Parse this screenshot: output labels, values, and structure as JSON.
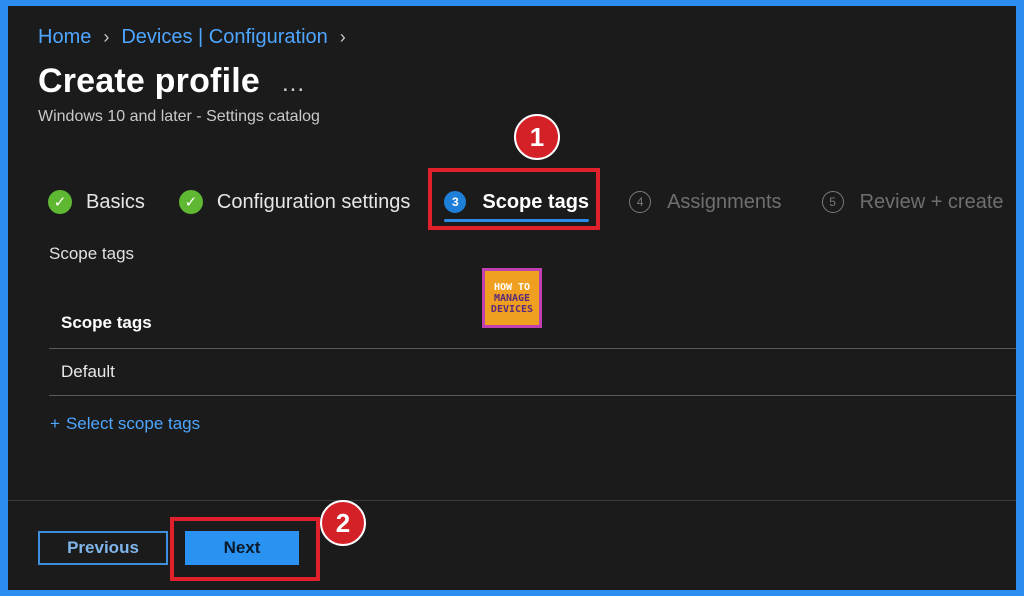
{
  "breadcrumb": {
    "items": [
      "Home",
      "Devices | Configuration"
    ]
  },
  "header": {
    "title": "Create profile",
    "more": "...",
    "subtitle": "Windows 10 and later - Settings catalog"
  },
  "tabs": [
    {
      "label": "Basics",
      "state": "completed"
    },
    {
      "label": "Configuration settings",
      "state": "completed"
    },
    {
      "label": "Scope tags",
      "number": "3",
      "state": "active"
    },
    {
      "label": "Assignments",
      "number": "4",
      "state": "disabled"
    },
    {
      "label": "Review + create",
      "number": "5",
      "state": "disabled"
    }
  ],
  "annotations": {
    "badge1": "1",
    "badge2": "2",
    "highlight_color": "#e0202a"
  },
  "main": {
    "section_label": "Scope tags",
    "table": {
      "header": "Scope tags",
      "rows": [
        "Default"
      ]
    },
    "select_link": {
      "plus": "+",
      "label": "Select scope tags"
    }
  },
  "logo": {
    "line1": "HOW TO",
    "line2": "MANAGE",
    "line3": "DEVICES"
  },
  "footer": {
    "previous_label": "Previous",
    "next_label": "Next"
  },
  "colors": {
    "accent": "#2a93f2",
    "link": "#4ea6ff",
    "success": "#5fb832",
    "background": "#1b1b1b",
    "frame": "#2b8df0"
  },
  "icons": {
    "completed": "check-circle-icon",
    "chevron": "chevron-right-icon",
    "more": "more-horizontal-icon"
  }
}
